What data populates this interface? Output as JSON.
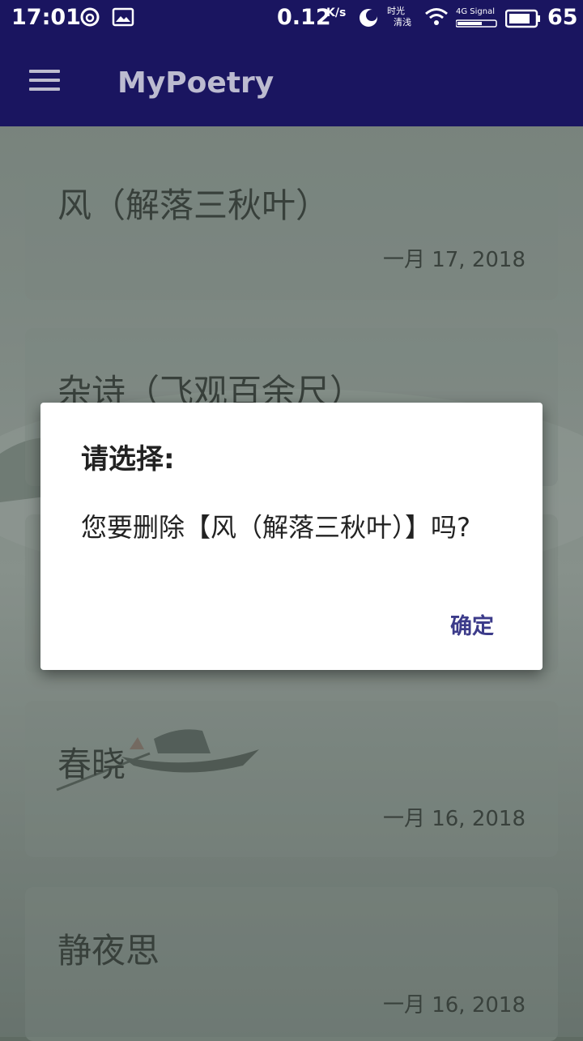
{
  "status_bar": {
    "time": "17:01",
    "speed": "0.12",
    "speed_unit": "K/s",
    "eye_mode_line1": "时光",
    "eye_mode_line2": "清浅",
    "signal_label": "4G Signal",
    "battery": "65"
  },
  "app_bar": {
    "title": "MyPoetry",
    "menu_icon": "hamburger-menu-icon"
  },
  "poems": [
    {
      "title": "风（解落三秋叶）",
      "date": "一月 17, 2018"
    },
    {
      "title": "杂诗（飞观百余尺）",
      "date": ""
    },
    {
      "title": "",
      "date": ""
    },
    {
      "title": "春晓",
      "date": "一月 16, 2018"
    },
    {
      "title": "静夜思",
      "date": "一月 16, 2018"
    }
  ],
  "dialog": {
    "title": "请选择:",
    "message": "您要删除【风（解落三秋叶）】吗?",
    "confirm_label": "确定"
  },
  "colors": {
    "primary": "#1a1560",
    "dialog_button": "#3c3b8a"
  }
}
